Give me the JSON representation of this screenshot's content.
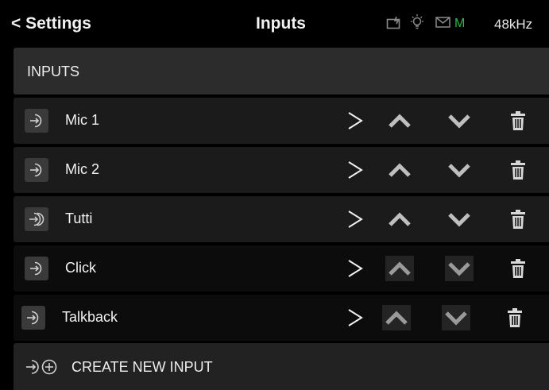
{
  "header": {
    "back_label": "< Settings",
    "title": "Inputs",
    "status": {
      "monitor_icon": "monitor-icon",
      "bulb_icon": "bulb-icon",
      "mail_icon": "mail-icon",
      "m_indicator": "M",
      "m_color": "#2fb84a",
      "sample_rate": "48kHz"
    }
  },
  "section": {
    "title": "INPUTS"
  },
  "inputs": [
    {
      "name": "Mic 1",
      "icon": "input-icon"
    },
    {
      "name": "Mic 2",
      "icon": "input-icon"
    },
    {
      "name": "Tutti",
      "icon": "stereo-input-icon"
    },
    {
      "name": "Click",
      "icon": "input-icon"
    },
    {
      "name": "Talkback",
      "icon": "input-icon"
    }
  ],
  "row_controls": {
    "open": "chevron-right-icon",
    "move_up": "chevron-up-icon",
    "move_down": "chevron-down-icon",
    "delete": "trash-icon"
  },
  "footer": {
    "create_label": "CREATE NEW INPUT",
    "icon": "add-input-icon"
  }
}
